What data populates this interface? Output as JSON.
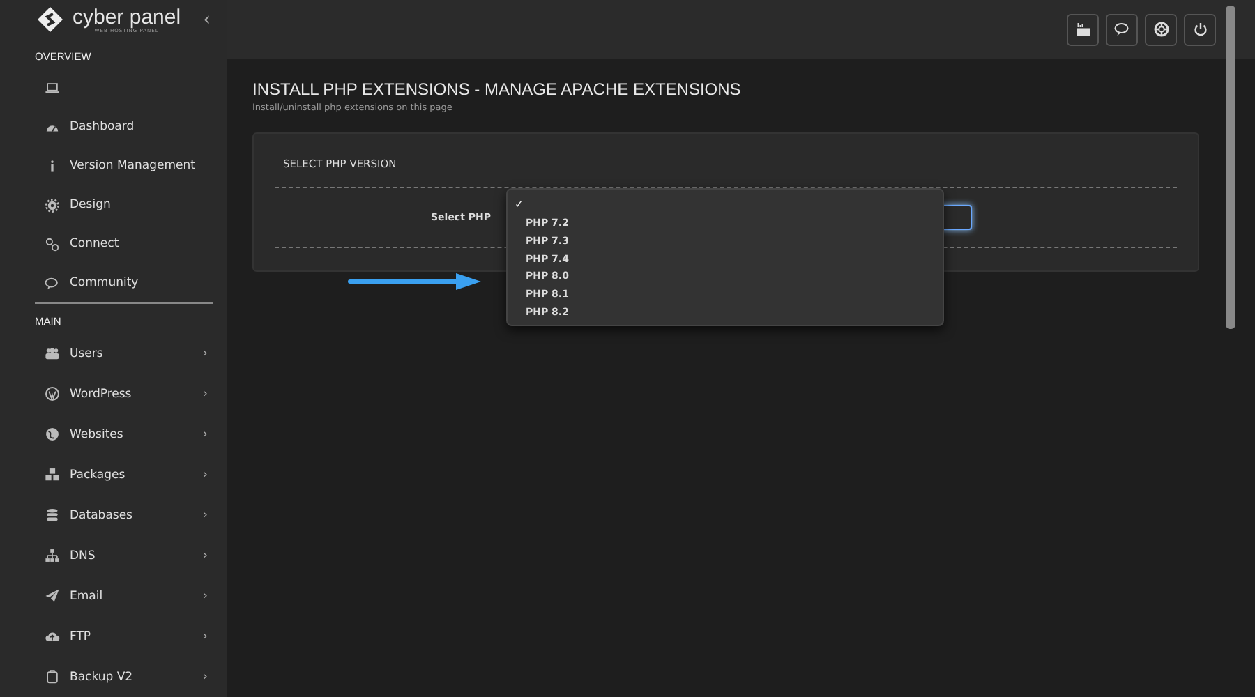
{
  "sidebar": {
    "logo": {
      "name": "cyber panel",
      "tagline": "WEB HOSTING PANEL"
    },
    "collapse": "‹",
    "sections": [
      {
        "title": "OVERVIEW",
        "items": [
          {
            "kind": "laptop"
          },
          {
            "kind": "dashboard",
            "label": "Dashboard"
          },
          {
            "kind": "info",
            "label": "Version Management"
          },
          {
            "kind": "gear",
            "label": "Design"
          },
          {
            "kind": "link",
            "label": "Connect"
          },
          {
            "kind": "chat",
            "label": "Community"
          }
        ]
      },
      {
        "title": "MAIN",
        "items": [
          {
            "kind": "users",
            "label": "Users",
            "arrow": "›"
          },
          {
            "kind": "wordpress",
            "label": "WordPress",
            "arrow": "›"
          },
          {
            "kind": "globe",
            "label": "Websites",
            "arrow": "›"
          },
          {
            "kind": "boxes",
            "label": "Packages",
            "arrow": "›"
          },
          {
            "kind": "database",
            "label": "Databases",
            "arrow": "›"
          },
          {
            "kind": "sitemap",
            "label": "DNS",
            "arrow": "›"
          },
          {
            "kind": "plane",
            "label": "Email",
            "arrow": "›"
          },
          {
            "kind": "cloud",
            "label": "FTP",
            "arrow": "›"
          },
          {
            "kind": "backup",
            "label": "Backup V2",
            "arrow": "›"
          }
        ]
      }
    ]
  },
  "topbar": {
    "buttons": [
      {
        "kind": "video"
      },
      {
        "kind": "chat"
      },
      {
        "kind": "lifebuoy"
      },
      {
        "kind": "power"
      }
    ]
  },
  "page": {
    "title": "INSTALL PHP EXTENSIONS - MANAGE APACHE EXTENSIONS",
    "subtitle": "Install/uninstall php extensions on this page"
  },
  "panel": {
    "heading": "SELECT PHP VERSION",
    "field_label": "Select PHP",
    "dropdown": {
      "expanded": true,
      "check_mark": "✓",
      "options": [
        {
          "label": "PHP 7.2",
          "selected": false
        },
        {
          "label": "PHP 7.3",
          "selected": false
        },
        {
          "label": "PHP 7.4",
          "selected": false
        },
        {
          "label": "PHP 8.0",
          "selected": false
        },
        {
          "label": "PHP 8.1",
          "selected": false
        },
        {
          "label": "PHP 8.2",
          "selected": false
        }
      ]
    }
  }
}
